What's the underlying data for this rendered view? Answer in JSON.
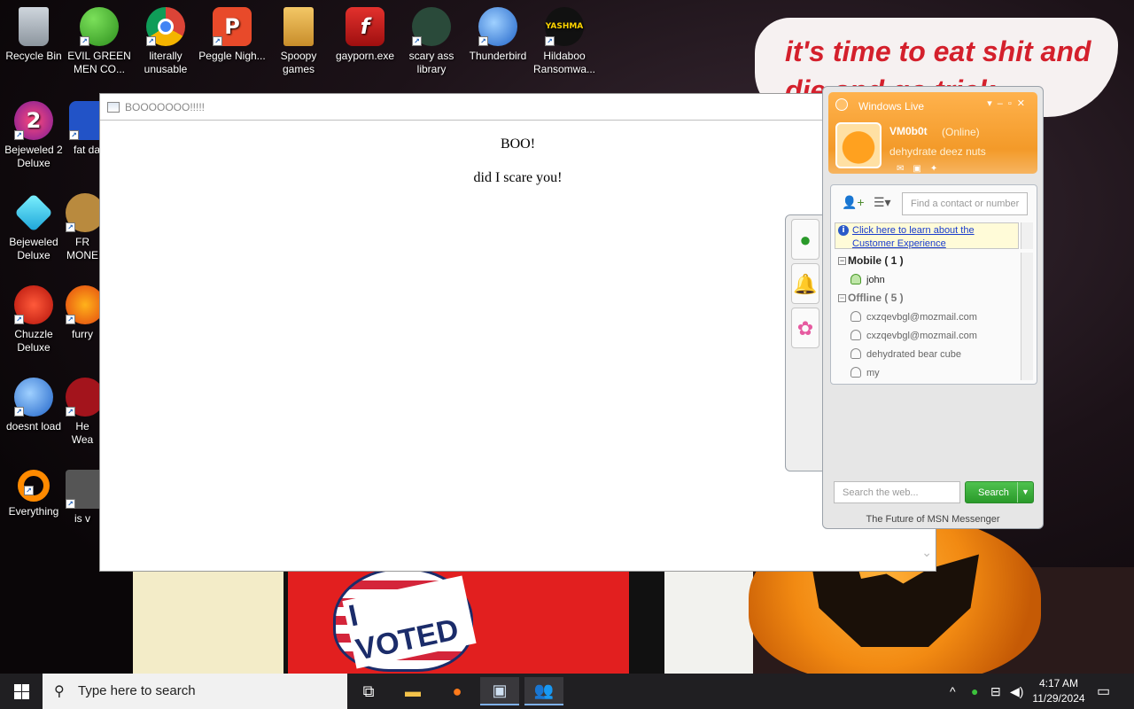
{
  "desktop": {
    "icons": [
      {
        "label": "Recycle Bin",
        "icon": "recycle-bin-icon"
      },
      {
        "label": "EVIL GREEN MEN CO...",
        "icon": "msn-people-icon"
      },
      {
        "label": "literally unusable",
        "icon": "chrome-icon"
      },
      {
        "label": "Peggle Nigh...",
        "icon": "peggle-icon"
      },
      {
        "label": "Spoopy games",
        "icon": "folder-icon"
      },
      {
        "label": "gayporn.exe",
        "icon": "flash-icon"
      },
      {
        "label": "scary ass library",
        "icon": "library-shield-icon"
      },
      {
        "label": "Thunderbird",
        "icon": "thunderbird-icon"
      },
      {
        "label": "Hildaboo Ransomwa...",
        "icon": "yashma-shield-icon"
      },
      {
        "label": "Bejeweled 2 Deluxe",
        "icon": "bejeweled2-icon"
      },
      {
        "label": "fat dar",
        "icon": "game-icon"
      },
      {
        "label": "Bejeweled Deluxe",
        "icon": "diamond-icon"
      },
      {
        "label": "FR MONE",
        "icon": "money-bag-icon"
      },
      {
        "label": "Chuzzle Deluxe",
        "icon": "chuzzle-icon"
      },
      {
        "label": "furry",
        "icon": "firefox-icon"
      },
      {
        "label": "doesnt load",
        "icon": "thunderbird-icon"
      },
      {
        "label": "He Wea",
        "icon": "game-icon"
      },
      {
        "label": "Everything",
        "icon": "search-ring-icon"
      },
      {
        "label": "is v",
        "icon": "shield-icon"
      }
    ],
    "wallpaper_text": "it's time to eat shit and die and go trick",
    "sticker_text": "I VOTED"
  },
  "popup": {
    "title": "BOOOOOOO!!!!!",
    "line1": "BOO!",
    "line2": "did I scare you!"
  },
  "messenger": {
    "brand": "Windows Live",
    "user": {
      "name": "VM0b0t",
      "status": "(Online)",
      "personal_message": "dehydrate deez nuts"
    },
    "find_placeholder": "Find a contact or number",
    "info_link": "Click here to learn about the Customer Experience",
    "groups": [
      {
        "name": "Mobile",
        "count": "( 1 )",
        "contacts": [
          "john"
        ]
      },
      {
        "name": "Offline",
        "count": "( 5 )",
        "contacts": [
          "cxzqevbgl@mozmail.com",
          "cxzqevbgl@mozmail.com",
          "dehydrated bear cube",
          "my"
        ]
      }
    ],
    "web_search_placeholder": "Search the web...",
    "search_button": "Search",
    "footer": "The Future of MSN Messenger"
  },
  "taskbar": {
    "search_placeholder": "Type here to search",
    "time": "4:17 AM",
    "date": "11/29/2024"
  }
}
